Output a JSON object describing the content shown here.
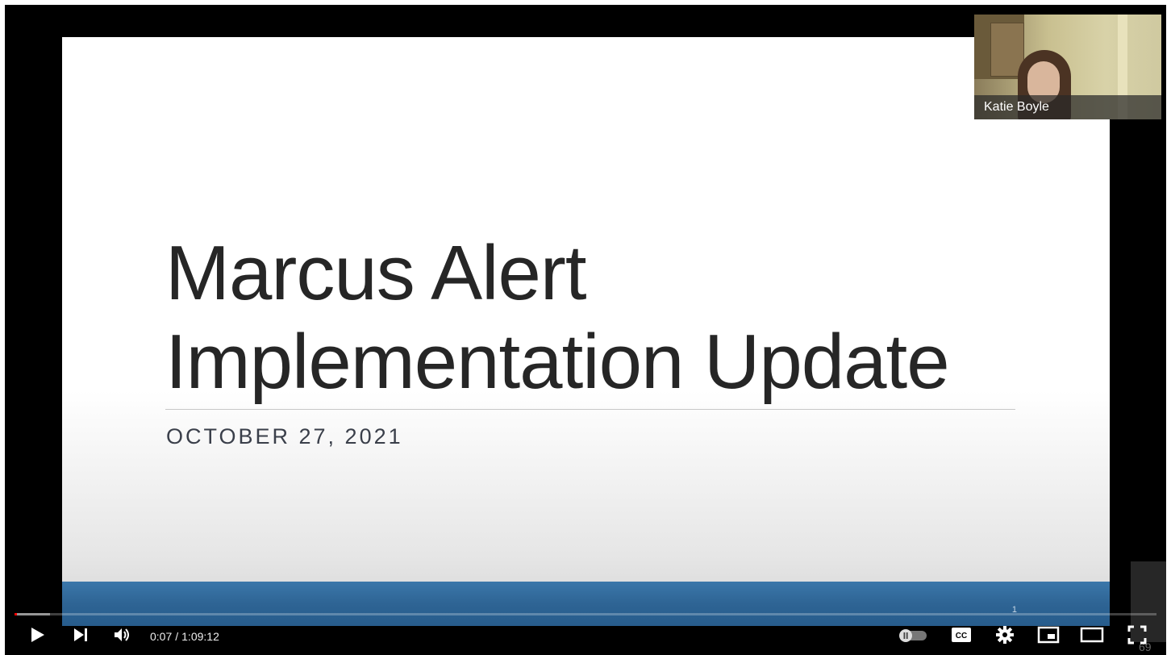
{
  "slide": {
    "title_line1": "Marcus Alert",
    "title_line2": "Implementation Update",
    "subtitle": "OCTOBER 27, 2021",
    "slide_number": "1"
  },
  "participant": {
    "name": "Katie Boyle"
  },
  "player": {
    "current_time": "0:07",
    "duration": "1:09:12",
    "played_fraction": 0.0017,
    "edge_number": "69",
    "colors": {
      "progress": "#ff0000",
      "band": "#2e6494"
    }
  },
  "icons": [
    "play-icon",
    "next-icon",
    "volume-icon",
    "autoplay-toggle-icon",
    "cc-icon",
    "settings-icon",
    "miniplayer-icon",
    "theater-icon",
    "fullscreen-icon"
  ]
}
